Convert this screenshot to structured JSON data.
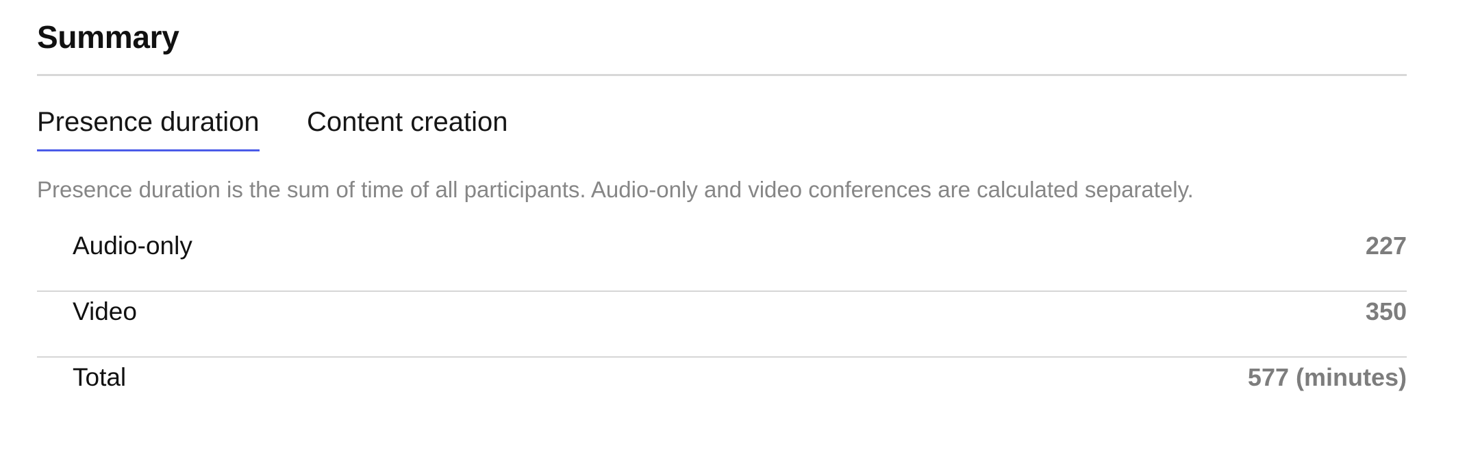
{
  "summary": {
    "title": "Summary",
    "tabs": [
      {
        "label": "Presence duration",
        "active": true
      },
      {
        "label": "Content creation",
        "active": false
      }
    ],
    "description": "Presence duration is the sum of time of all participants. Audio-only and video conferences are calculated separately.",
    "rows": [
      {
        "label": "Audio-only",
        "value": "227"
      },
      {
        "label": "Video",
        "value": "350"
      },
      {
        "label": "Total",
        "value": "577 (minutes)"
      }
    ]
  },
  "colors": {
    "active_tab_underline": "#4a5ae8",
    "value_text": "#7d7d7d",
    "description_text": "#868686",
    "divider": "#d8d8d8"
  }
}
